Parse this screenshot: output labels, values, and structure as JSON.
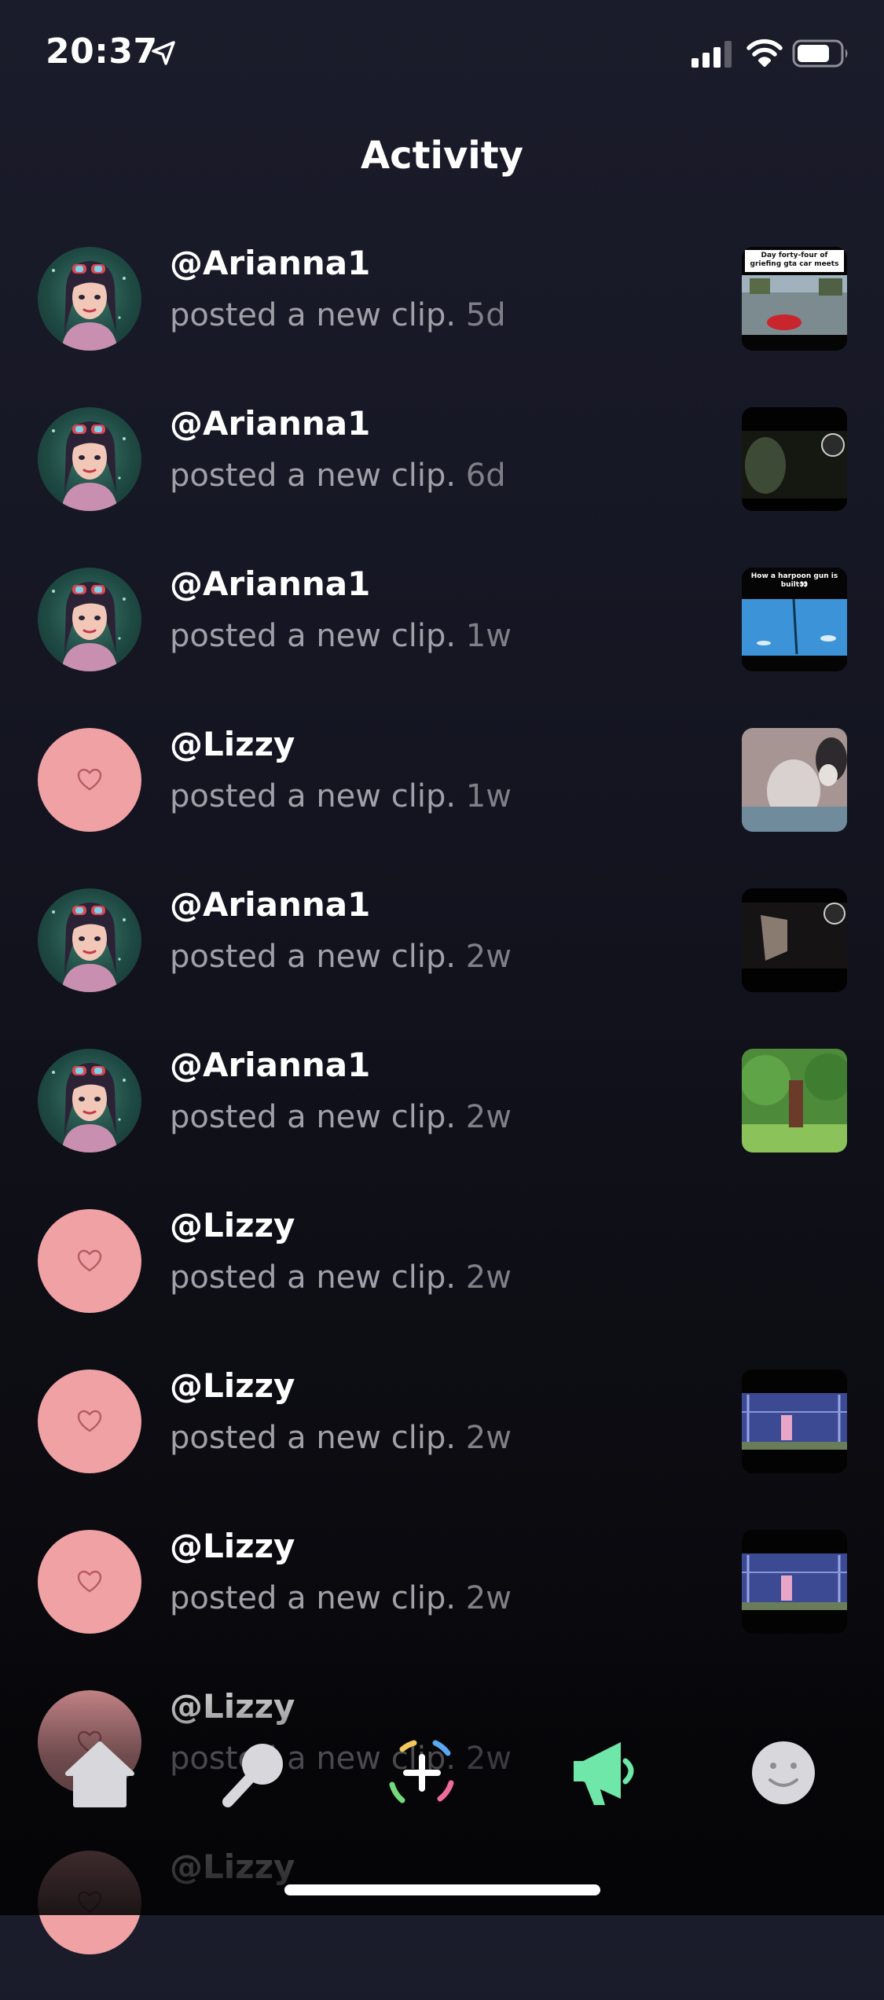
{
  "status_bar": {
    "time": "20:37",
    "icons": [
      "location-arrow-icon",
      "cellular-signal-icon",
      "wifi-icon",
      "battery-icon"
    ]
  },
  "page": {
    "title": "Activity"
  },
  "activity": [
    {
      "user": "@Arianna1",
      "action": "posted a new clip.",
      "age": "5d",
      "avatar": "character-art",
      "thumbnail": {
        "caption": "Day forty-four of griefing gta car meets",
        "scene": "gta-car"
      }
    },
    {
      "user": "@Arianna1",
      "action": "posted a new clip.",
      "age": "6d",
      "avatar": "character-art",
      "thumbnail": {
        "caption": "",
        "scene": "dark-cave"
      }
    },
    {
      "user": "@Arianna1",
      "action": "posted a new clip.",
      "age": "1w",
      "avatar": "character-art",
      "thumbnail": {
        "caption": "How a harpoon gun is built👀",
        "scene": "underwater"
      }
    },
    {
      "user": "@Lizzy",
      "action": "posted a new clip.",
      "age": "1w",
      "avatar": "pink-heart",
      "thumbnail": {
        "caption": "",
        "scene": "animals"
      }
    },
    {
      "user": "@Arianna1",
      "action": "posted a new clip.",
      "age": "2w",
      "avatar": "character-art",
      "thumbnail": {
        "caption": "",
        "scene": "dark-room"
      }
    },
    {
      "user": "@Arianna1",
      "action": "posted a new clip.",
      "age": "2w",
      "avatar": "character-art",
      "thumbnail": {
        "caption": "",
        "scene": "forest"
      }
    },
    {
      "user": "@Lizzy",
      "action": "posted a new clip.",
      "age": "2w",
      "avatar": "pink-heart",
      "thumbnail": null
    },
    {
      "user": "@Lizzy",
      "action": "posted a new clip.",
      "age": "2w",
      "avatar": "pink-heart",
      "thumbnail": {
        "caption": "",
        "scene": "fortnite-build"
      }
    },
    {
      "user": "@Lizzy",
      "action": "posted a new clip.",
      "age": "2w",
      "avatar": "pink-heart",
      "thumbnail": {
        "caption": "",
        "scene": "fortnite-build"
      }
    },
    {
      "user": "@Lizzy",
      "action": "posted a new clip.",
      "age": "2w",
      "avatar": "pink-heart",
      "thumbnail": null
    },
    {
      "user": "@Lizzy",
      "action": "",
      "age": "",
      "avatar": "pink-heart",
      "thumbnail": null
    }
  ],
  "tab_bar": {
    "tabs": [
      {
        "name": "home",
        "icon": "home-icon"
      },
      {
        "name": "search",
        "icon": "search-icon"
      },
      {
        "name": "create",
        "icon": "plus-icon"
      },
      {
        "name": "announcements",
        "icon": "megaphone-icon"
      },
      {
        "name": "profile",
        "icon": "smiley-face-icon"
      }
    ]
  },
  "colors": {
    "background_top": "#1b1c2b",
    "background_bottom": "#050507",
    "text_primary": "#ffffff",
    "text_secondary": "#9fa0a8",
    "avatar_pink": "#f0a1a4",
    "accent_green": "#6ee7a8"
  }
}
